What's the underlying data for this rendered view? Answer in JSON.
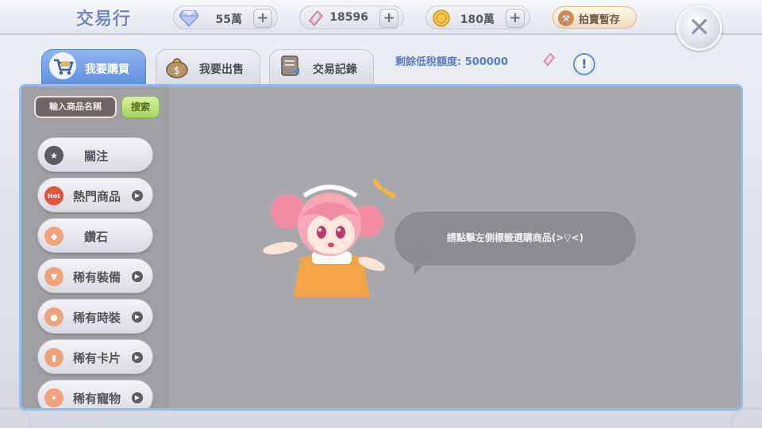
{
  "header": {
    "title": "交易行",
    "currencies": [
      {
        "icon": "diamond-icon",
        "value": "55萬"
      },
      {
        "icon": "crystal-icon",
        "value": "18596"
      },
      {
        "icon": "zeny-coin-icon",
        "value": "180萬"
      }
    ],
    "auction_label": "拍賣暫存",
    "close_icon": "close-icon"
  },
  "tabs": [
    {
      "label": "我要購買",
      "icon": "cart-icon",
      "active": true
    },
    {
      "label": "我要出售",
      "icon": "money-bag-icon",
      "active": false
    },
    {
      "label": "交易記錄",
      "icon": "record-icon",
      "active": false
    }
  ],
  "quota": {
    "text": "剩餘低稅額度: 500000"
  },
  "search": {
    "placeholder": "輸入商品名稱",
    "button_label": "搜索"
  },
  "categories": [
    {
      "label": "關注",
      "icon": "star-icon",
      "arrow": false
    },
    {
      "label": "熱門商品",
      "icon": "hot-icon",
      "icon_text": "Hot",
      "arrow": true
    },
    {
      "label": "鑽石",
      "icon": "diamond-icon",
      "arrow": false
    },
    {
      "label": "稀有裝備",
      "icon": "armor-icon",
      "arrow": true
    },
    {
      "label": "稀有時裝",
      "icon": "costume-icon",
      "arrow": true
    },
    {
      "label": "稀有卡片",
      "icon": "card-icon",
      "arrow": true
    },
    {
      "label": "稀有寵物",
      "icon": "pet-bone-icon",
      "arrow": true
    }
  ],
  "content": {
    "hint": "請點擊左側標籤選購商品(>▽<)"
  },
  "colors": {
    "accent_blue": "#5f8fe0",
    "panel_bg": "#a5a4a8",
    "search_green": "#a9d35f"
  }
}
